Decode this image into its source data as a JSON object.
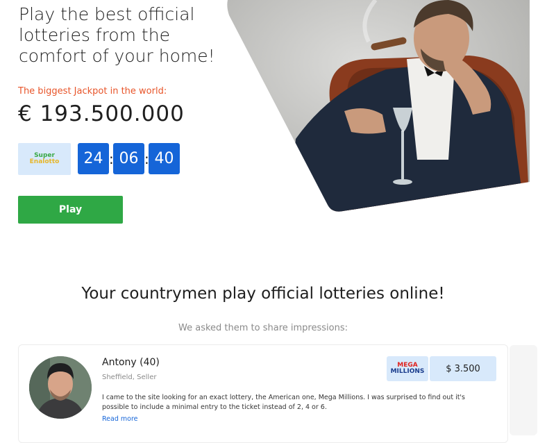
{
  "hero": {
    "title": "Play the best official lotteries from the comfort of your home!",
    "jackpot_label": "The biggest Jackpot in the world:",
    "jackpot_amount": "€ 193.500.000",
    "lottery_logo": {
      "line1": "Super",
      "line2": "Enalotto"
    },
    "countdown": {
      "hours": "24",
      "minutes": "06",
      "seconds": "40",
      "separator": ":"
    },
    "play_label": "Play",
    "accent_color": "#e8552a",
    "timer_color": "#1565d8",
    "play_color": "#2fa845"
  },
  "section": {
    "title": "Your countrymen play official lotteries online!",
    "subtitle": "We asked them to share impressions:"
  },
  "review": {
    "name": "Antony (40)",
    "meta": "Sheffield, Seller",
    "text": "I came to the site looking for an exact lottery, the American one, Mega Millions. I was surprised to find out it's possible to include a minimal entry to the ticket instead of 2, 4 or 6.",
    "read_more": "Read more",
    "lottery_logo": {
      "line1": "MEGA",
      "line2": "MILLIONS"
    },
    "win_amount": "$ 3.500"
  }
}
